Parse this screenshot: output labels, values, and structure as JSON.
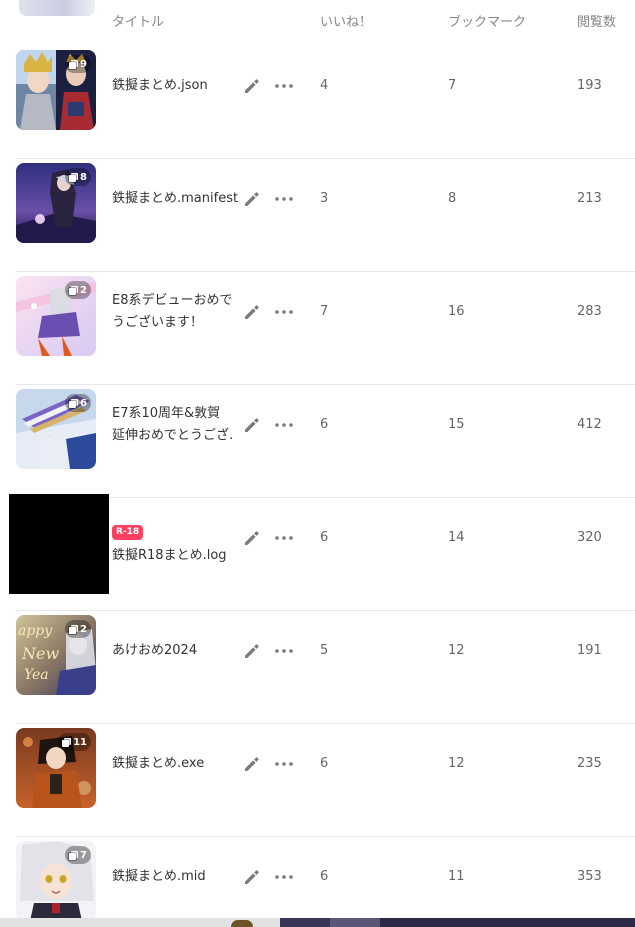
{
  "header": {
    "title": "タイトル",
    "likes": "いいね！",
    "bookmarks": "ブックマーク",
    "views": "閲覧数"
  },
  "rows": [
    {
      "title": "鉄擬まとめ.json",
      "pages": "9",
      "likes": "4",
      "bookmarks": "7",
      "views": "193"
    },
    {
      "title": "鉄擬まとめ.manifest",
      "pages": "8",
      "likes": "3",
      "bookmarks": "8",
      "views": "213"
    },
    {
      "title_line1": "E8系デビューおめでと",
      "title_line2": "うございます！",
      "pages": "2",
      "likes": "7",
      "bookmarks": "16",
      "views": "283"
    },
    {
      "title_line1": "E7系10周年&敦賀",
      "title_line2": "延伸おめでとうござ…",
      "pages": "6",
      "likes": "6",
      "bookmarks": "15",
      "views": "412"
    },
    {
      "title": "鉄擬R18まとめ.log",
      "badge": "R-18",
      "likes": "6",
      "bookmarks": "14",
      "views": "320"
    },
    {
      "title": "あけおめ2024",
      "pages": "2",
      "likes": "5",
      "bookmarks": "12",
      "views": "191",
      "thumb_text_1": "appy",
      "thumb_text_2": "New",
      "thumb_text_3": "Yea"
    },
    {
      "title": "鉄擬まとめ.exe",
      "pages": "11",
      "likes": "6",
      "bookmarks": "12",
      "views": "235"
    },
    {
      "title": "鉄擬まとめ.mid",
      "pages": "7",
      "likes": "6",
      "bookmarks": "11",
      "views": "353"
    }
  ],
  "icons": {
    "edit": "pencil-icon",
    "more": "more-horizontal-icon",
    "pages": "pages-icon"
  },
  "colors": {
    "r18_badge": "#ff4060",
    "header_text": "#858585",
    "divider": "#e7e7e7"
  }
}
